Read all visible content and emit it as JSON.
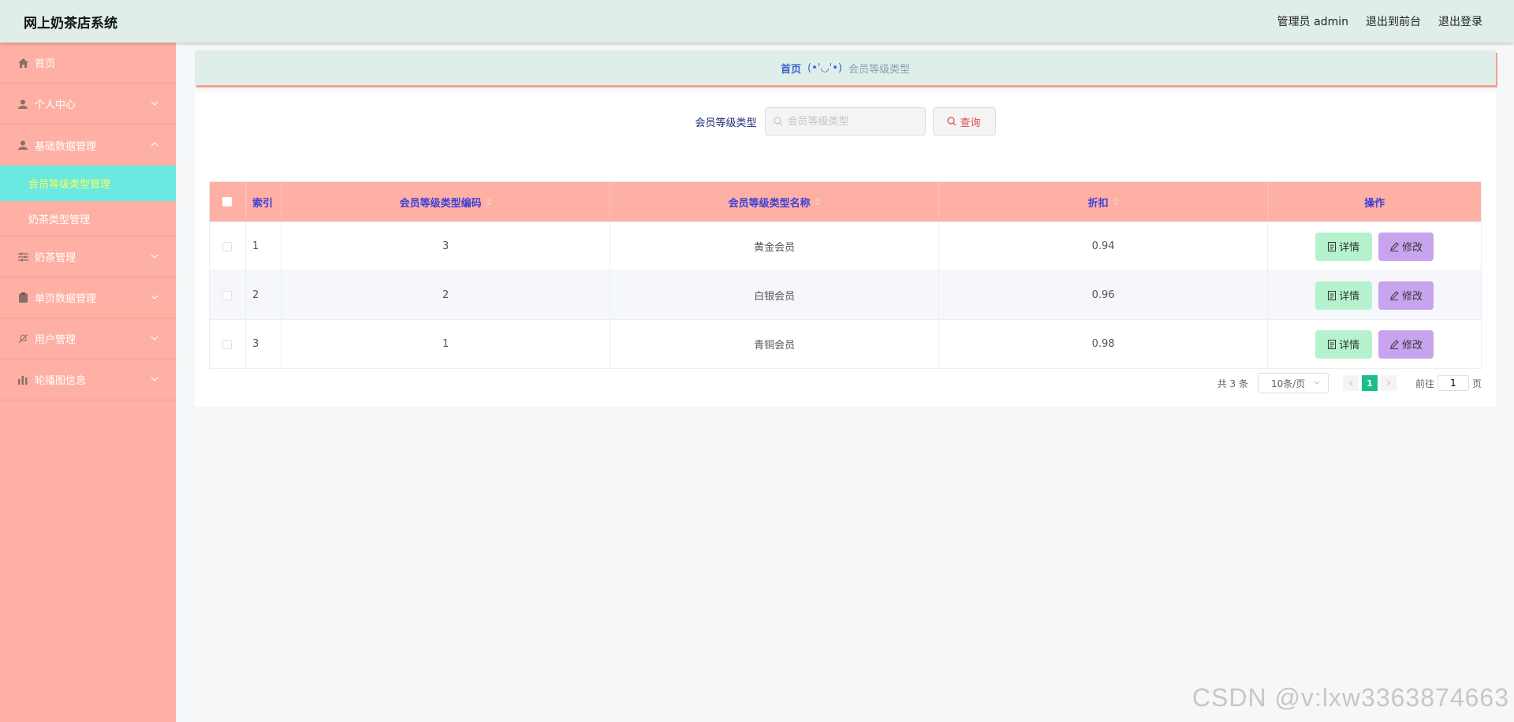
{
  "header": {
    "title": "网上奶茶店系统",
    "user": "管理员 admin",
    "links": [
      "退出到前台",
      "退出登录"
    ]
  },
  "sidebar": {
    "items": [
      {
        "label": "首页",
        "icon": "home-icon"
      },
      {
        "label": "个人中心",
        "icon": "user-icon"
      },
      {
        "label": "基础数据管理",
        "icon": "user-icon",
        "expanded": true,
        "children": [
          {
            "label": "会员等级类型管理",
            "active": true
          },
          {
            "label": "奶茶类型管理"
          }
        ]
      },
      {
        "label": "奶茶管理",
        "icon": "sliders-icon"
      },
      {
        "label": "单页数据管理",
        "icon": "clipboard-icon"
      },
      {
        "label": "用户管理",
        "icon": "bell-off-icon"
      },
      {
        "label": "轮播图信息",
        "icon": "bar-chart-icon"
      }
    ]
  },
  "breadcrumb": {
    "home": "首页",
    "separator": "(•'◡'•)",
    "current": "会员等级类型"
  },
  "search": {
    "label": "会员等级类型",
    "placeholder": "会员等级类型",
    "button": "查询"
  },
  "table": {
    "headers": {
      "index": "索引",
      "code": "会员等级类型编码",
      "name": "会员等级类型名称",
      "discount": "折扣",
      "ops": "操作"
    },
    "rows": [
      {
        "index": "1",
        "code": "3",
        "name": "黄金会员",
        "discount": "0.94"
      },
      {
        "index": "2",
        "code": "2",
        "name": "白银会员",
        "discount": "0.96"
      },
      {
        "index": "3",
        "code": "1",
        "name": "青铜会员",
        "discount": "0.98"
      }
    ],
    "detail_label": "详情",
    "edit_label": "修改"
  },
  "pager": {
    "total": "共 3 条",
    "page_size": "10条/页",
    "current_page": "1",
    "goto_label": "前往",
    "goto_value": "1",
    "goto_suffix": "页"
  },
  "watermark": "CSDN @v:lxw3363874663",
  "colors": {
    "header_bg": "#dfeee8",
    "sidebar_bg": "#ffb0a4",
    "active_bg": "#6ae8e2",
    "active_text": "#f8ff5a",
    "detail_btn": "#b5f2cd",
    "edit_btn": "#c9a4ee",
    "page_active": "#19be8a"
  }
}
